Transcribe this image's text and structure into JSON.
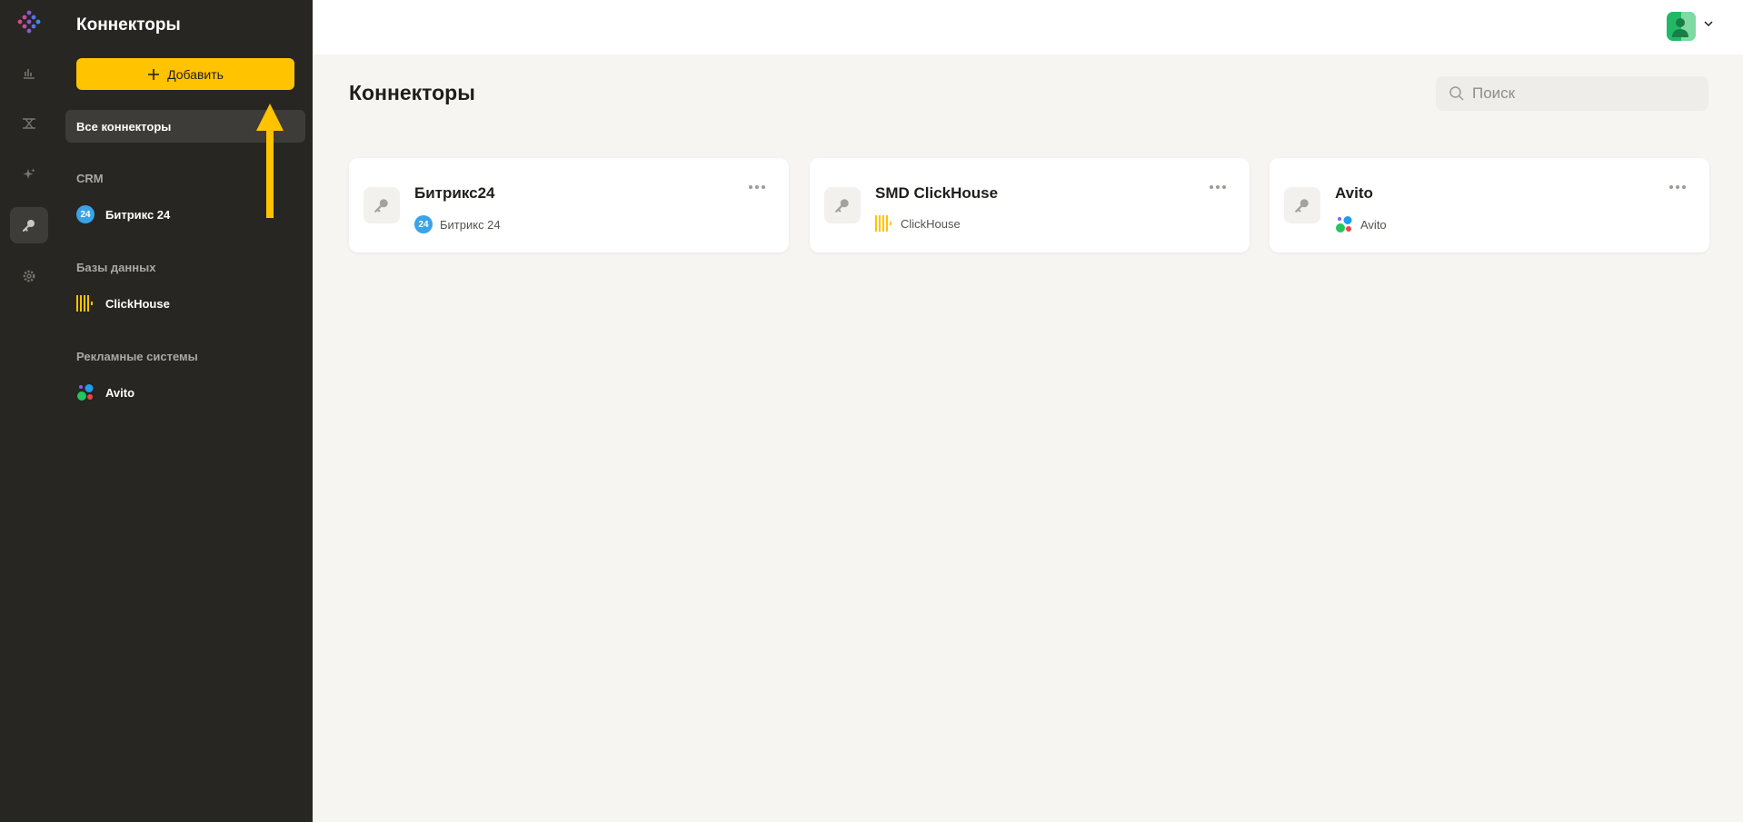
{
  "sidebar": {
    "title": "Коннекторы",
    "add_label": "Добавить",
    "all_label": "Все коннекторы",
    "groups": [
      {
        "label": "CRM",
        "items": [
          {
            "label": "Битрикс 24",
            "icon": "bitrix24-icon"
          }
        ]
      },
      {
        "label": "Базы данных",
        "items": [
          {
            "label": "ClickHouse",
            "icon": "clickhouse-icon"
          }
        ]
      },
      {
        "label": "Рекламные системы",
        "items": [
          {
            "label": "Avito",
            "icon": "avito-icon"
          }
        ]
      }
    ]
  },
  "main": {
    "title": "Коннекторы",
    "search": {
      "placeholder": "Поиск",
      "value": ""
    },
    "cards": [
      {
        "title": "Битрикс24",
        "source": "Битрикс 24",
        "icon": "bitrix24-icon"
      },
      {
        "title": "SMD ClickHouse",
        "source": "ClickHouse",
        "icon": "clickhouse-icon"
      },
      {
        "title": "Avito",
        "source": "Avito",
        "icon": "avito-icon"
      }
    ]
  },
  "icons": {
    "b24_text": "24"
  },
  "colors": {
    "accent": "#ffc300",
    "sidebar_bg": "#272622",
    "page_bg": "#f6f5f2",
    "avatar": "#22b866"
  }
}
